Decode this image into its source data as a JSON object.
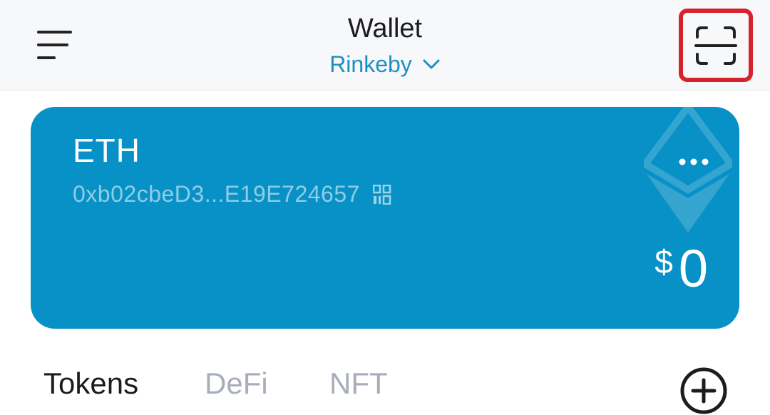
{
  "header": {
    "title": "Wallet",
    "network": "Rinkeby",
    "icons": {
      "menu": "hamburger-menu-icon",
      "chevron": "chevron-down-icon",
      "scan": "scan-icon"
    }
  },
  "card": {
    "symbol": "ETH",
    "address": "0xb02cbeD3...E19E724657",
    "currency_symbol": "$",
    "balance": "0",
    "icons": {
      "qr": "qr-code-icon",
      "more": "more-dots-icon",
      "watermark": "ethereum-logo-icon"
    },
    "colors": {
      "background": "#0891c6"
    }
  },
  "tabs": [
    {
      "label": "Tokens",
      "active": true
    },
    {
      "label": "DeFi",
      "active": false
    },
    {
      "label": "NFT",
      "active": false
    }
  ],
  "actions": {
    "add_icon": "add-circle-icon"
  },
  "colors": {
    "accent": "#1e8fc2",
    "highlight_border": "#d5232b",
    "inactive_tab": "#a7adba"
  }
}
